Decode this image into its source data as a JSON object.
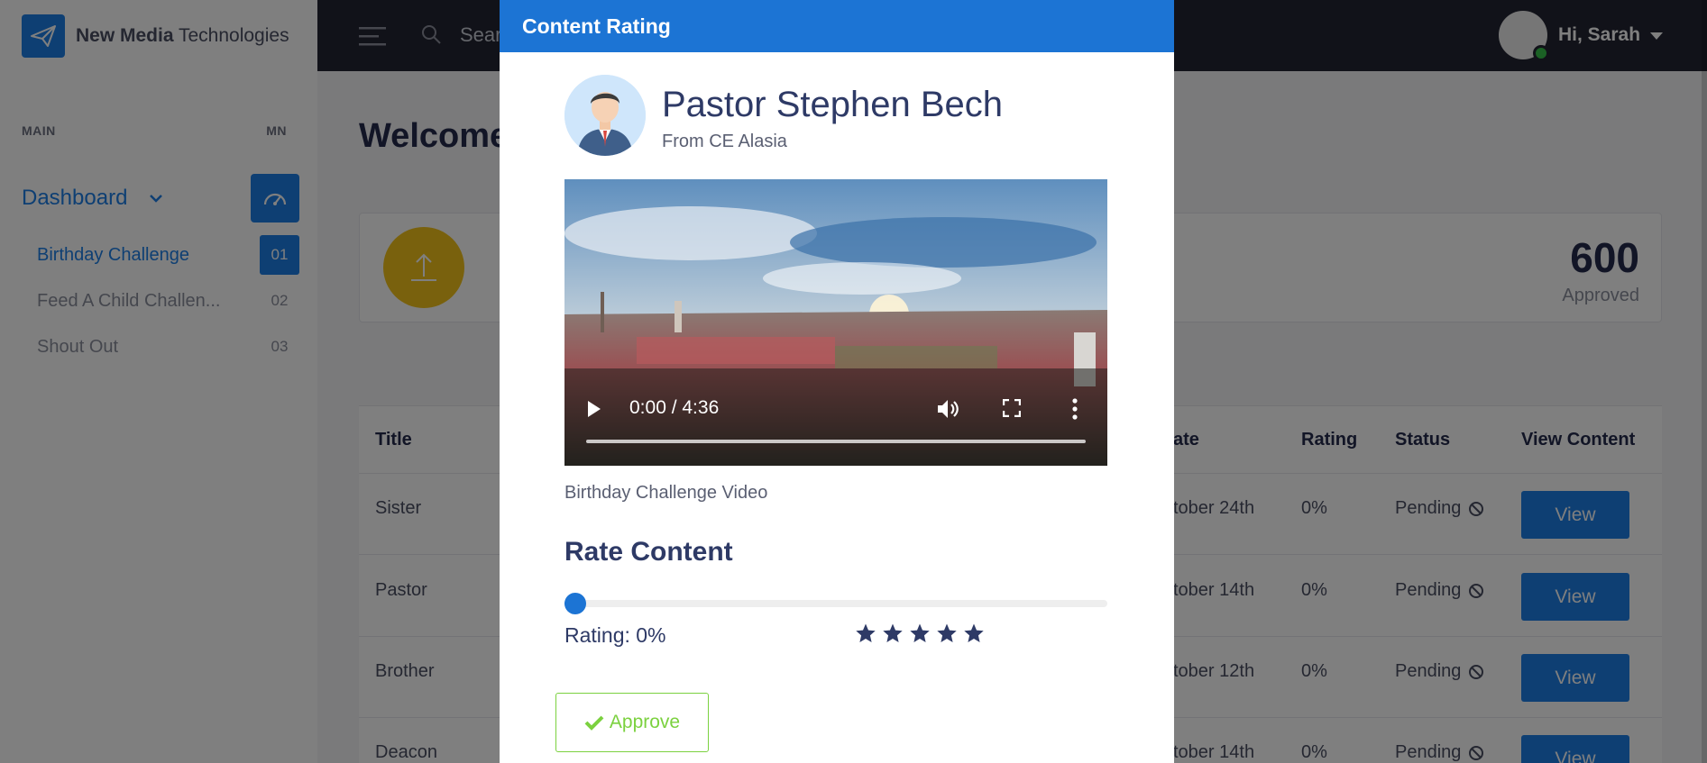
{
  "brand": {
    "name_bold": "New Media",
    "name_rest": " Technologies"
  },
  "sidebar": {
    "section_main": "MAIN",
    "section_short": "MN",
    "dashboard_label": "Dashboard",
    "items": [
      {
        "label": "Birthday Challenge",
        "num": "01"
      },
      {
        "label": "Feed A Child Challen...",
        "num": "02"
      },
      {
        "label": "Shout Out",
        "num": "03"
      }
    ]
  },
  "topbar": {
    "search_placeholder": "Sear",
    "greeting": "Hi, Sarah"
  },
  "main": {
    "welcome": "Welcome",
    "stat": {
      "value": "600",
      "label": "Approved"
    },
    "table": {
      "headers": {
        "title": "Title",
        "date": "ate",
        "rating": "Rating",
        "status": "Status",
        "view": "View Content"
      },
      "rows": [
        {
          "title": "Sister",
          "date": "tober 24th",
          "rating": "0%",
          "status": "Pending",
          "view": "View"
        },
        {
          "title": "Pastor",
          "date": "tober 14th",
          "rating": "0%",
          "status": "Pending",
          "view": "View"
        },
        {
          "title": "Brother",
          "date": "tober 12th",
          "rating": "0%",
          "status": "Pending",
          "view": "View"
        },
        {
          "title": "Deacon",
          "date": "tober 14th",
          "rating": "0%",
          "status": "Pending",
          "view": "View"
        }
      ]
    }
  },
  "modal": {
    "title": "Content Rating",
    "profile_name": "Pastor Stephen Bech",
    "profile_from": "From CE Alasia",
    "video": {
      "time": "0:00 / 4:36",
      "progress": 0
    },
    "video_caption": "Birthday Challenge Video",
    "rate_title": "Rate Content",
    "rating_value": 0,
    "rating_label": "Rating: 0%",
    "stars": 5,
    "approve_label": "Approve"
  },
  "colors": {
    "primary": "#1c74d4",
    "success": "#7bd13f",
    "accent_yellow": "#f2c21a",
    "topbar": "#232532"
  }
}
